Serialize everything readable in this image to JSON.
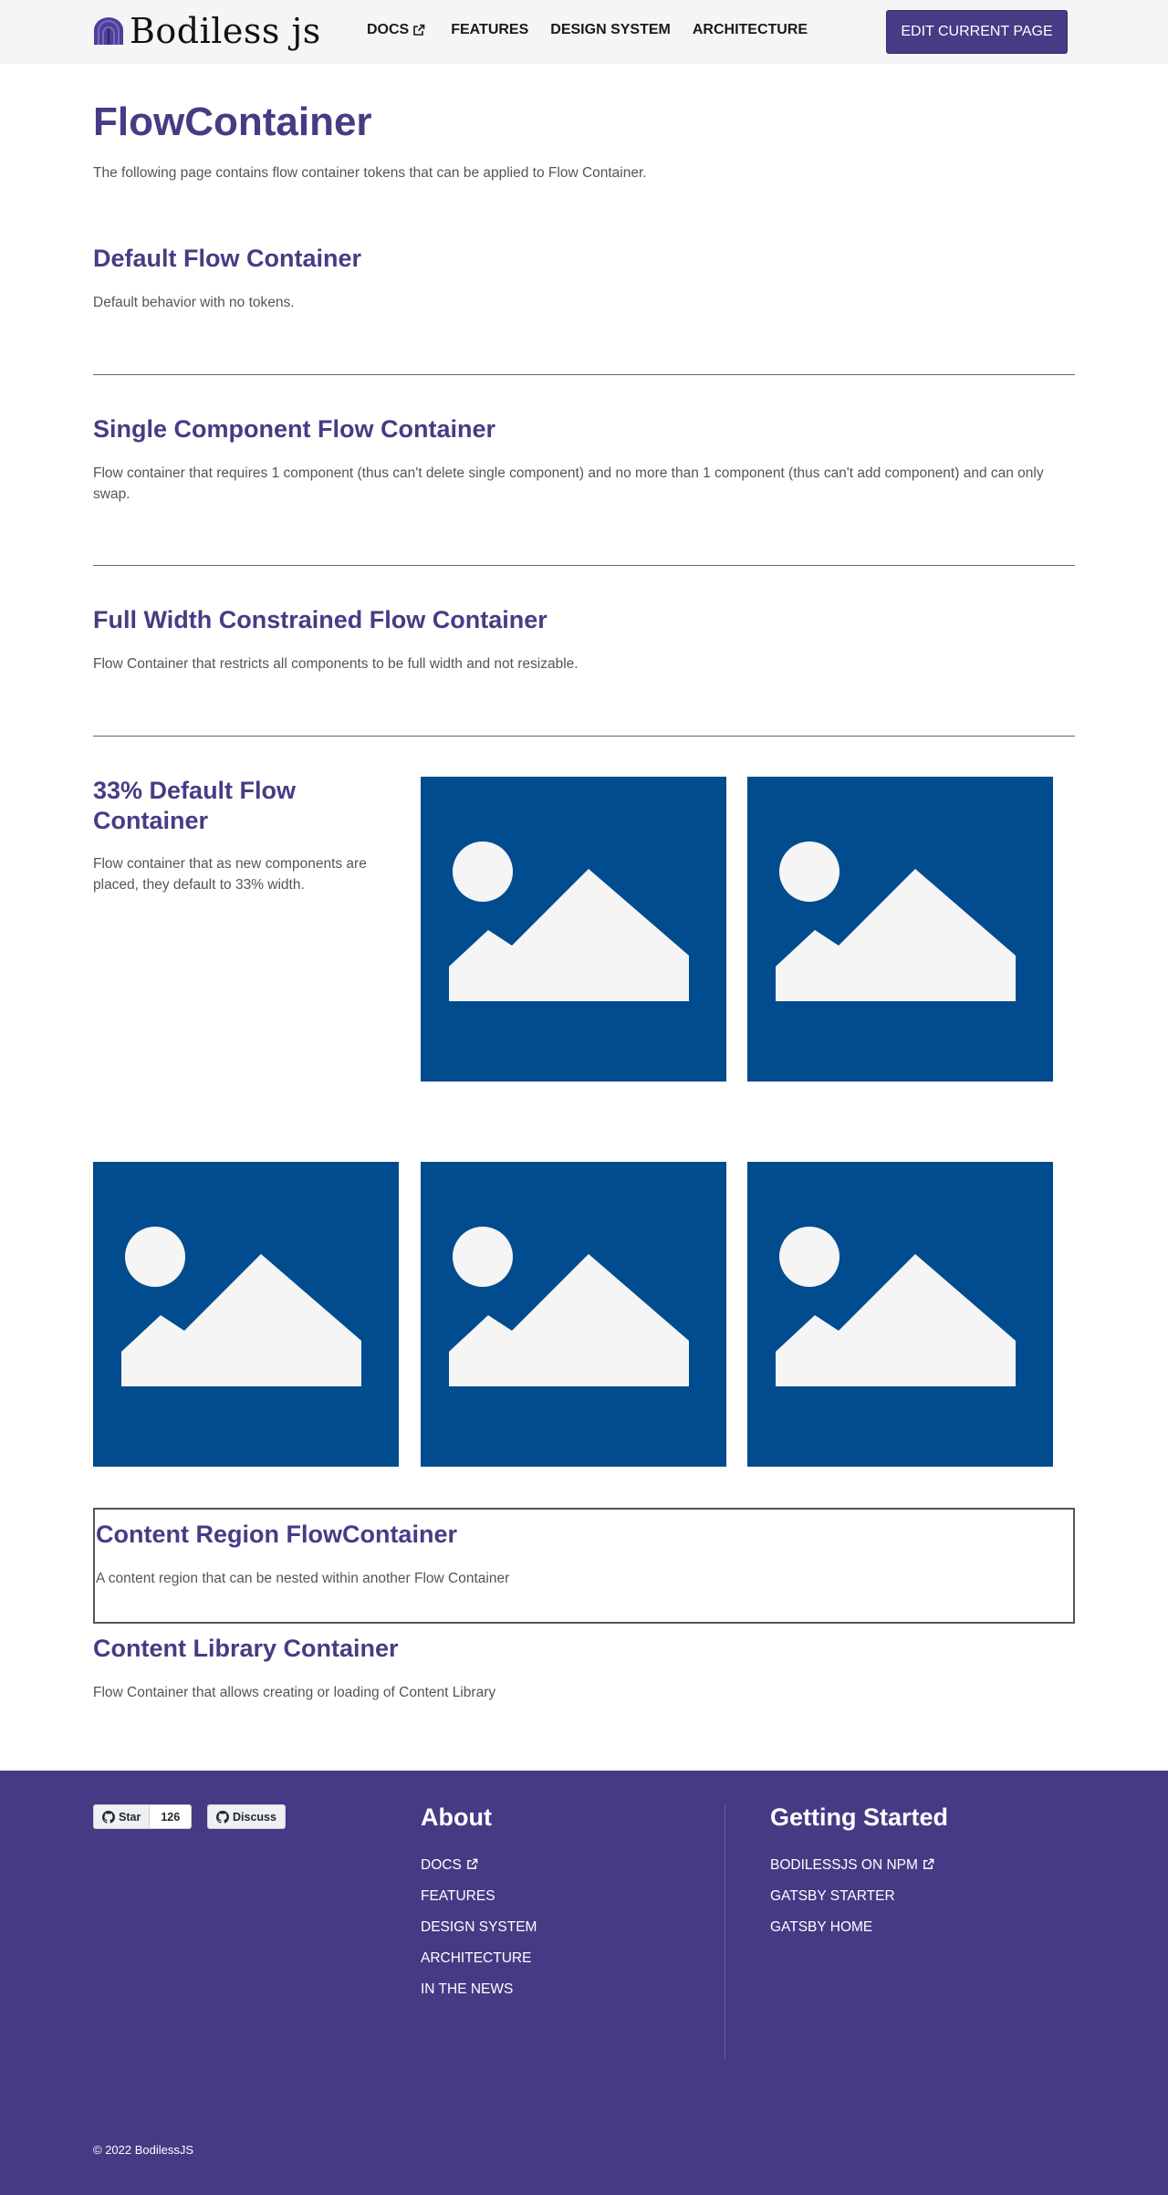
{
  "header": {
    "logo_text": "Bodiless js",
    "nav": [
      {
        "label": "DOCS",
        "external": true
      },
      {
        "label": "FEATURES",
        "external": false
      },
      {
        "label": "DESIGN SYSTEM",
        "external": false
      },
      {
        "label": "ARCHITECTURE",
        "external": false
      }
    ],
    "edit_button": "EDIT CURRENT PAGE"
  },
  "page": {
    "title": "FlowContainer",
    "intro": "The following page contains flow container tokens that can be applied to Flow Container."
  },
  "sections": {
    "default": {
      "title": "Default Flow Container",
      "desc": "Default behavior with no tokens."
    },
    "single": {
      "title": "Single Component Flow Container",
      "desc": "Flow container that requires 1 component (thus can't delete single component) and no more than 1 component (thus can't add component) and can only swap."
    },
    "full_width": {
      "title": "Full Width Constrained Flow Container",
      "desc": "Flow Container that restricts all components to be full width and not resizable."
    },
    "third": {
      "title": "33% Default Flow Container",
      "desc": "Flow container that as new components are placed, they default to 33% width."
    },
    "content_region": {
      "title": "Content Region FlowContainer",
      "desc": "A content region that can be nested within another Flow Container"
    },
    "content_library": {
      "title": "Content Library Container",
      "desc": "Flow Container that allows creating or loading of Content Library"
    }
  },
  "images": {
    "icon": "image-placeholder-icon",
    "count": 5
  },
  "colors": {
    "brand": "#483b85",
    "footer_bg": "#463a85",
    "image_bg": "#004c8e",
    "image_fg": "#f5f5f5"
  },
  "footer": {
    "star_label": "Star",
    "star_count": "126",
    "discuss_label": "Discuss",
    "about_title": "About",
    "about_links": [
      "DOCS",
      "FEATURES",
      "DESIGN SYSTEM",
      "ARCHITECTURE",
      "IN THE NEWS"
    ],
    "getting_started_title": "Getting Started",
    "getting_started_links": [
      "BODILESSJS ON NPM",
      "GATSBY STARTER",
      "GATSBY HOME"
    ],
    "copyright": "©  2022 BodilessJS"
  }
}
